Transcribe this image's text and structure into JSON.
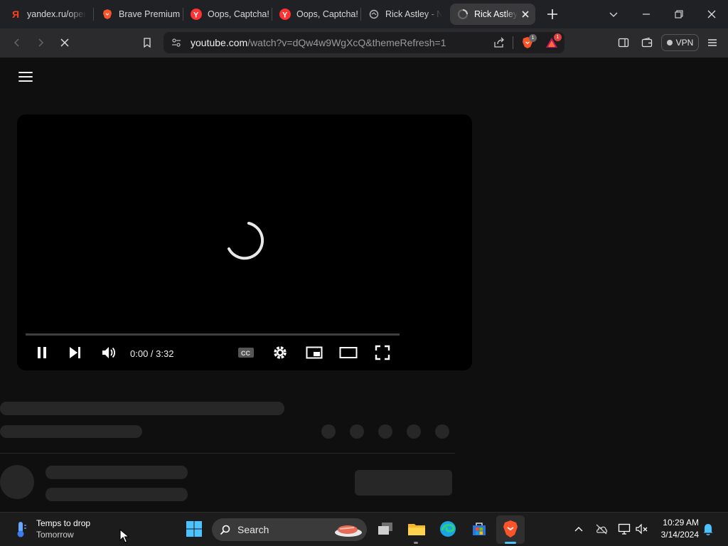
{
  "browser": {
    "tabs": [
      {
        "title": "yandex.ru/oper",
        "icon": "yandex-icon"
      },
      {
        "title": "Brave Premium",
        "icon": "brave-icon"
      },
      {
        "title": "Oops, Captcha!",
        "icon": "yandex-browser-icon"
      },
      {
        "title": "Oops, Captcha!",
        "icon": "yandex-browser-icon"
      },
      {
        "title": "Rick Astley - N",
        "icon": "globe-icon"
      },
      {
        "title": "Rick Astley",
        "icon": "loading-icon",
        "active": true
      }
    ],
    "url_host": "youtube.com",
    "url_path": "/watch?v=dQw4w9WgXcQ&themeRefresh=1",
    "shield_badge": "1",
    "rewards_badge": "1",
    "vpn_label": "VPN"
  },
  "player": {
    "timecode": "0:00 / 3:32",
    "progress": 0
  },
  "taskbar": {
    "weather_title": "Temps to drop",
    "weather_subtitle": "Tomorrow",
    "search_label": "Search",
    "time": "10:29 AM",
    "date": "3/14/2024"
  },
  "colors": {
    "brave_orange": "#fb542b",
    "page_bg": "#0f0f0f",
    "skeleton": "#272727",
    "edge_blue": "#1aa5e8",
    "windows_blue": "#4cc2ff"
  }
}
